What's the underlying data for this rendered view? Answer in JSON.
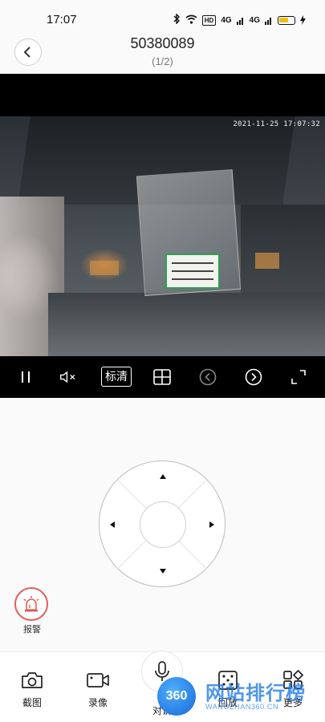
{
  "status_bar": {
    "time": "17:07",
    "hd": "HD",
    "signal1": "4G",
    "signal2": "4G"
  },
  "header": {
    "title": "50380089",
    "subtitle": "(1/2)"
  },
  "video": {
    "timestamp": "2021-11-25 17:07:32"
  },
  "controls": {
    "quality_label": "标清"
  },
  "alarm": {
    "label": "报警",
    "color": "#e0605b"
  },
  "toolbar": {
    "items": [
      {
        "label": "截图",
        "icon": "camera-icon"
      },
      {
        "label": "录像",
        "icon": "video-camera-icon"
      },
      {
        "label": "对讲",
        "icon": "microphone-icon"
      },
      {
        "label": "回放",
        "icon": "playback-icon"
      },
      {
        "label": "更多",
        "icon": "more-grid-icon"
      }
    ]
  },
  "watermark": {
    "logo": "360",
    "text": "网站排行榜",
    "sub": "WANGZHAN360.CN"
  }
}
